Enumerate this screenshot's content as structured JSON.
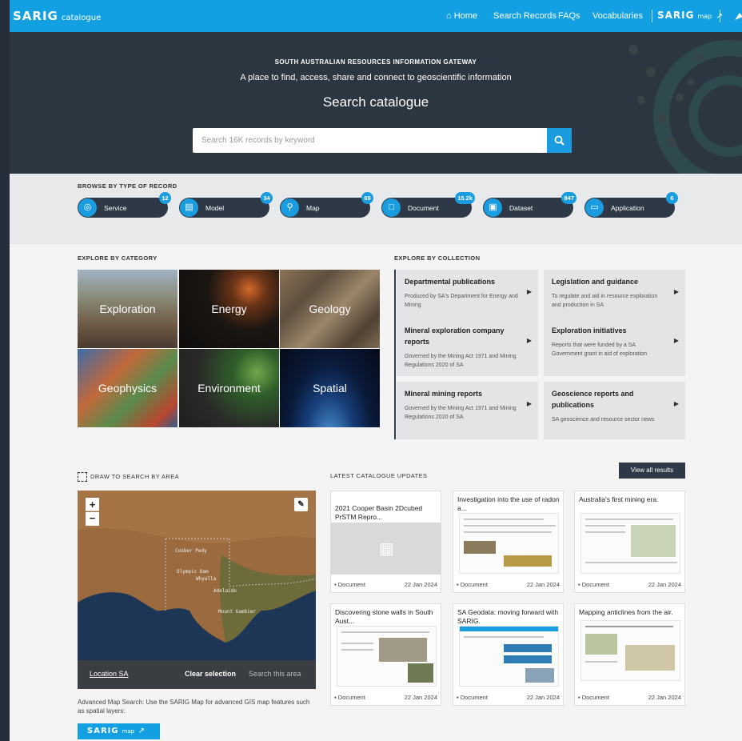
{
  "nav": {
    "brand": "SARIG",
    "brand_sub": "catalogue",
    "home": "Home",
    "search_records": "Search Records",
    "faqs": "FAQs",
    "vocabularies": "Vocabularies",
    "sarig_map": "SARIG",
    "sarig_map_sub": "map"
  },
  "hero": {
    "kicker": "SOUTH AUSTRALIAN RESOURCES INFORMATION GATEWAY",
    "tagline": "A place to find, access, share and connect to geoscientific information",
    "title": "Search catalogue",
    "search_placeholder": "Search 16K records by keyword"
  },
  "browse": {
    "label": "BROWSE BY TYPE OF RECORD",
    "types": [
      {
        "label": "Service",
        "count": "12",
        "icon": "service-icon"
      },
      {
        "label": "Model",
        "count": "34",
        "icon": "model-icon"
      },
      {
        "label": "Map",
        "count": "69",
        "icon": "map-pin-icon"
      },
      {
        "label": "Document",
        "count": "15.2k",
        "icon": "document-icon"
      },
      {
        "label": "Dataset",
        "count": "847",
        "icon": "dataset-icon"
      },
      {
        "label": "Application",
        "count": "6",
        "icon": "application-icon"
      }
    ]
  },
  "category": {
    "label": "EXPLORE BY CATEGORY",
    "tiles": [
      "Exploration",
      "Energy",
      "Geology",
      "Geophysics",
      "Environment",
      "Spatial"
    ]
  },
  "collection": {
    "label": "EXPLORE BY COLLECTION",
    "items": [
      {
        "title": "Departmental publications",
        "desc": "Produced by SA's Department for Energy and Mining"
      },
      {
        "title": "Legislation and guidance",
        "desc": "To regulate and aid in resource exploration and production in SA"
      },
      {
        "title": "Mineral exploration company reports",
        "desc": "Governed by the Mining Act 1971 and Mining Regulations 2020 of SA"
      },
      {
        "title": "Exploration initiatives",
        "desc": "Reports that were funded by a SA Government grant in aid of exploration"
      },
      {
        "title": "Mineral mining reports",
        "desc": "Governed by the Mining Act 1971 and Mining Regulations 2020 of SA"
      },
      {
        "title": "Geoscience reports and publications",
        "desc": "SA geoscience and resource sector news"
      }
    ]
  },
  "area": {
    "label": "DRAW TO SEARCH BY AREA",
    "zoom_in": "+",
    "zoom_out": "−",
    "places": [
      "Coober Pedy",
      "Olympic Dam",
      "Whyalla",
      "Adelaide",
      "Mount Gambier"
    ],
    "location": "Location SA",
    "clear": "Clear selection",
    "search_area": "Search this area",
    "advanced": "Advanced Map Search: Use the SARIG Map for advanced GIS map features such as spatial layers:",
    "map_btn": "SARIG",
    "map_btn_sub": "map"
  },
  "updates": {
    "label": "LATEST CATALOGUE UPDATES",
    "view_all": "View all results",
    "cards": [
      {
        "title": "2021 Cooper Basin 2Dcubed PrSTM Repro...",
        "kind": "Document",
        "date": "22 Jan 2024"
      },
      {
        "title": "Investigation into the use of radon a...",
        "kind": "Document",
        "date": "22 Jan 2024"
      },
      {
        "title": "Australia's first mining era.",
        "kind": "Document",
        "date": "22 Jan 2024"
      },
      {
        "title": "Discovering stone walls in South Aust...",
        "kind": "Document",
        "date": "22 Jan 2024"
      },
      {
        "title": "SA Geodata: moving forward with SARIG.",
        "kind": "Document",
        "date": "22 Jan 2024"
      },
      {
        "title": "Mapping anticlines from the air.",
        "kind": "Document",
        "date": "22 Jan 2024"
      }
    ]
  }
}
